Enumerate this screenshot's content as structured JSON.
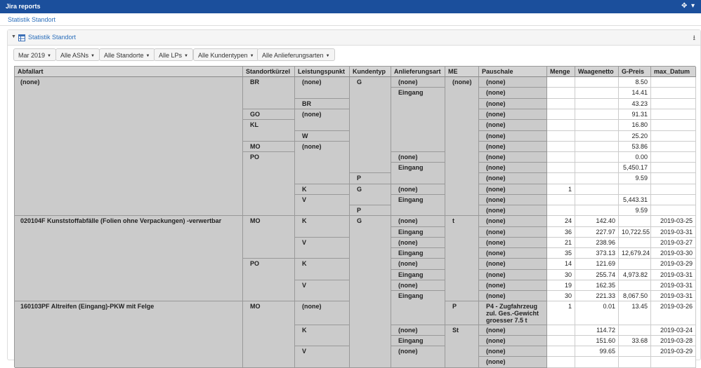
{
  "app": {
    "title": "Jira reports",
    "breadcrumb": "Statistik Standort",
    "move_icon": "move-icon",
    "collapse_icon": "collapse-icon"
  },
  "panel": {
    "title": "Statistik Standort",
    "table_icon": "table-icon",
    "download_icon": "download-icon"
  },
  "filters": [
    "Mar 2019",
    "Alle ASNs",
    "Alle Standorte",
    "Alle LPs",
    "Alle Kundentypen",
    "Alle Anlieferungsarten"
  ],
  "table": {
    "headers": [
      "Abfallart",
      "Standortkürzel",
      "Leistungspunkt",
      "Kundentyp",
      "Anlieferungsart",
      "ME",
      "Pauschale",
      "Menge",
      "Waagenetto",
      "G-Preis",
      "max_Datum"
    ],
    "groups": {
      "abfallart": [
        "(none)",
        "020104F Kunststoffabfälle (Folien ohne Verpackungen) -verwertbar",
        "160103PF Altreifen (Eingang)-PKW mit Felge"
      ],
      "standort": [
        "BR",
        "GO",
        "KL",
        "MO",
        "PO",
        "MO",
        "PO",
        "MO"
      ],
      "leistungspunkt": [
        "(none)",
        "BR",
        "(none)",
        "W",
        "(none)",
        "K",
        "V",
        "K",
        "V",
        "K",
        "V",
        "(none)",
        "K",
        "V"
      ],
      "kundentyp": [
        "G",
        "P",
        "G",
        "P",
        "G"
      ],
      "anlieferungsart": [
        "(none)",
        "Eingang",
        "(none)",
        "Eingang",
        "(none)",
        "Eingang",
        "(none)",
        "Eingang",
        "(none)",
        "Eingang",
        "(none)",
        "Eingang",
        "(none)",
        "Eingang",
        "(none)",
        "Eingang",
        "(none)"
      ],
      "me": [
        "(none)",
        "t",
        "P",
        "St"
      ]
    },
    "rows": [
      {
        "pauschale": "(none)",
        "menge": "",
        "waagenetto": "",
        "gpreis": "8.50",
        "datum": ""
      },
      {
        "pauschale": "(none)",
        "menge": "",
        "waagenetto": "",
        "gpreis": "14.41",
        "datum": ""
      },
      {
        "pauschale": "(none)",
        "menge": "",
        "waagenetto": "",
        "gpreis": "43.23",
        "datum": ""
      },
      {
        "pauschale": "(none)",
        "menge": "",
        "waagenetto": "",
        "gpreis": "91.31",
        "datum": ""
      },
      {
        "pauschale": "(none)",
        "menge": "",
        "waagenetto": "",
        "gpreis": "16.80",
        "datum": ""
      },
      {
        "pauschale": "(none)",
        "menge": "",
        "waagenetto": "",
        "gpreis": "25.20",
        "datum": ""
      },
      {
        "pauschale": "(none)",
        "menge": "",
        "waagenetto": "",
        "gpreis": "53.86",
        "datum": ""
      },
      {
        "pauschale": "(none)",
        "menge": "",
        "waagenetto": "",
        "gpreis": "0.00",
        "datum": ""
      },
      {
        "pauschale": "(none)",
        "menge": "",
        "waagenetto": "",
        "gpreis": "5,450.17",
        "datum": ""
      },
      {
        "pauschale": "(none)",
        "menge": "",
        "waagenetto": "",
        "gpreis": "9.59",
        "datum": ""
      },
      {
        "pauschale": "(none)",
        "menge": "1",
        "waagenetto": "",
        "gpreis": "",
        "datum": ""
      },
      {
        "pauschale": "(none)",
        "menge": "",
        "waagenetto": "",
        "gpreis": "5,443.31",
        "datum": ""
      },
      {
        "pauschale": "(none)",
        "menge": "",
        "waagenetto": "",
        "gpreis": "9.59",
        "datum": ""
      },
      {
        "pauschale": "(none)",
        "menge": "24",
        "waagenetto": "142.40",
        "gpreis": "",
        "datum": "2019-03-25"
      },
      {
        "pauschale": "(none)",
        "menge": "36",
        "waagenetto": "227.97",
        "gpreis": "10,722.55",
        "datum": "2019-03-31"
      },
      {
        "pauschale": "(none)",
        "menge": "21",
        "waagenetto": "238.96",
        "gpreis": "",
        "datum": "2019-03-27"
      },
      {
        "pauschale": "(none)",
        "menge": "35",
        "waagenetto": "373.13",
        "gpreis": "12,679.24",
        "datum": "2019-03-30"
      },
      {
        "pauschale": "(none)",
        "menge": "14",
        "waagenetto": "121.69",
        "gpreis": "",
        "datum": "2019-03-29"
      },
      {
        "pauschale": "(none)",
        "menge": "30",
        "waagenetto": "255.74",
        "gpreis": "4,973.82",
        "datum": "2019-03-31"
      },
      {
        "pauschale": "(none)",
        "menge": "19",
        "waagenetto": "162.35",
        "gpreis": "",
        "datum": "2019-03-31"
      },
      {
        "pauschale": "(none)",
        "menge": "30",
        "waagenetto": "221.33",
        "gpreis": "8,067.50",
        "datum": "2019-03-31"
      },
      {
        "pauschale": "P4 - Zugfahrzeug zul. Ges.-Gewicht groesser 7.5 t",
        "menge": "1",
        "waagenetto": "0.01",
        "gpreis": "13.45",
        "datum": "2019-03-26"
      },
      {
        "pauschale": "(none)",
        "menge": "",
        "waagenetto": "114.72",
        "gpreis": "",
        "datum": "2019-03-24"
      },
      {
        "pauschale": "(none)",
        "menge": "",
        "waagenetto": "151.60",
        "gpreis": "33.68",
        "datum": "2019-03-28"
      },
      {
        "pauschale": "(none)",
        "menge": "",
        "waagenetto": "99.65",
        "gpreis": "",
        "datum": "2019-03-29"
      },
      {
        "pauschale": "(none)",
        "menge": "",
        "waagenetto": "",
        "gpreis": "",
        "datum": ""
      }
    ]
  }
}
